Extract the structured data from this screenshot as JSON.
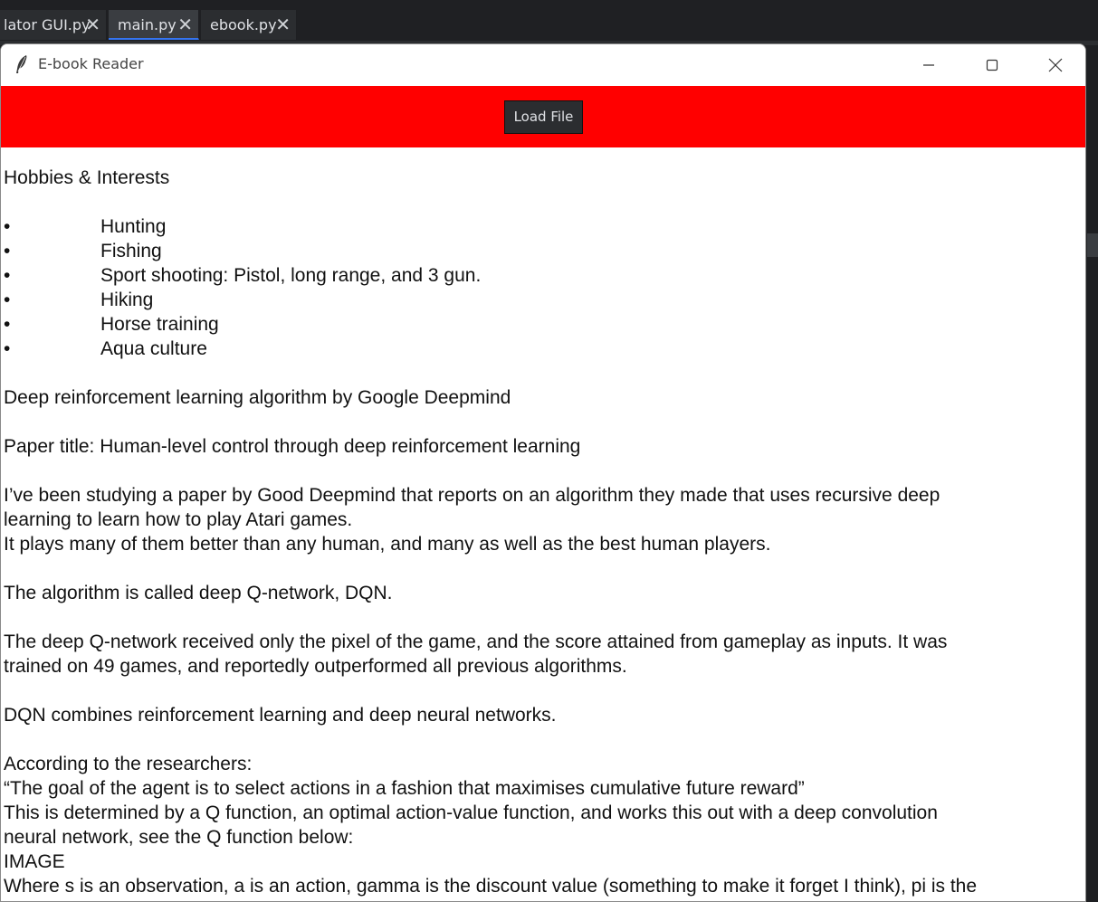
{
  "editor": {
    "tabs": [
      {
        "label": "lator GUI.py",
        "close": "✕"
      },
      {
        "label": "main.py",
        "close": "✕"
      },
      {
        "label": "ebook.py",
        "close": "✕"
      }
    ]
  },
  "window": {
    "title": "E-book Reader",
    "icon": "feather-icon",
    "controls": [
      "minimize-icon",
      "maximize-icon",
      "close-icon"
    ]
  },
  "toolbar": {
    "background": "#ff0000",
    "load_label": "Load File"
  },
  "document": {
    "heading": "Hobbies & Interests",
    "bullet_char": "•",
    "bullets": [
      "Hunting",
      "Fishing",
      "Sport shooting: Pistol, long range, and 3 gun.",
      "Hiking",
      "Horse training",
      "Aqua culture"
    ],
    "p1": "Deep reinforcement learning algorithm by Google Deepmind",
    "p2": "Paper title: Human-level control through deep reinforcement learning",
    "p3a": "I’ve been studying a paper by Good Deepmind that reports on an algorithm they made that uses recursive deep",
    "p3b": "learning to learn how to play Atari games.",
    "p3c": "It plays many of them better than any human, and many as well as the best human players.",
    "p4": "The algorithm is called deep Q-network, DQN.",
    "p5a": "The deep Q-network received only the pixel of the game, and the score attained from gameplay as inputs. It was",
    "p5b": "trained on 49 games, and reportedly outperformed all previous algorithms.",
    "p6": "DQN combines reinforcement learning and deep neural networks.",
    "p7a": "According to the researchers:",
    "p7b": "“The goal of the agent is to select actions in a fashion that maximises cumulative future reward”",
    "p7c": "This is determined by a Q function, an optimal action-value function, and works this out with a deep convolution",
    "p7d": "neural network, see the Q function below:",
    "p7e": "IMAGE",
    "p7f": "Where s is an observation, a is an action, gamma is the discount value (something to make it forget I think), pi is the"
  }
}
